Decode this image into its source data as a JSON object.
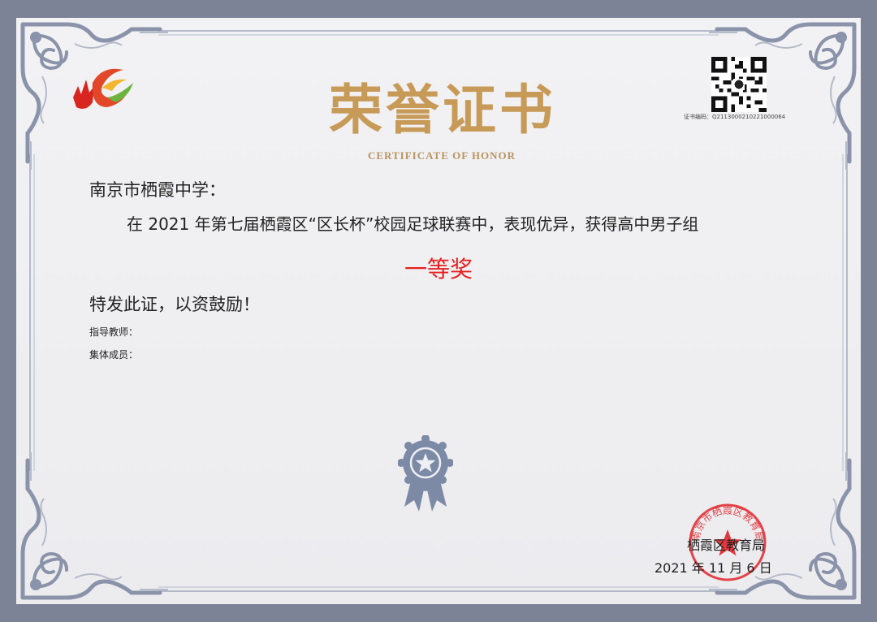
{
  "certificate": {
    "title": "荣誉证书",
    "subtitle": "CERTIFICATE OF HONOR",
    "qr_caption": "证书编码：Q2113000210221000064",
    "recipient": "南京市栖霞中学：",
    "body": "在 2021 年第七届栖霞区“区长杯”校园足球联赛中，表现优异，获得高中男子组",
    "award": "一等奖",
    "closing": "特发此证，以资鼓励！",
    "instructor_label": "指导教师：",
    "members_label": "集体成员：",
    "issuer": "栖霞区教育局",
    "date": "2021 年 11 月 6 日",
    "seal_text": "南京市栖霞区教育局"
  },
  "colors": {
    "outer_background": "#7d8397",
    "paper": "#efeff1",
    "title_gold": "#c79a57",
    "award_red": "#e8201e",
    "seal_red": "#e0252a",
    "ornament": "#8a93aa"
  },
  "icons": [
    "logo-icon",
    "qr-code-icon",
    "medal-icon",
    "seal-icon",
    "corner-ornament-icon"
  ]
}
